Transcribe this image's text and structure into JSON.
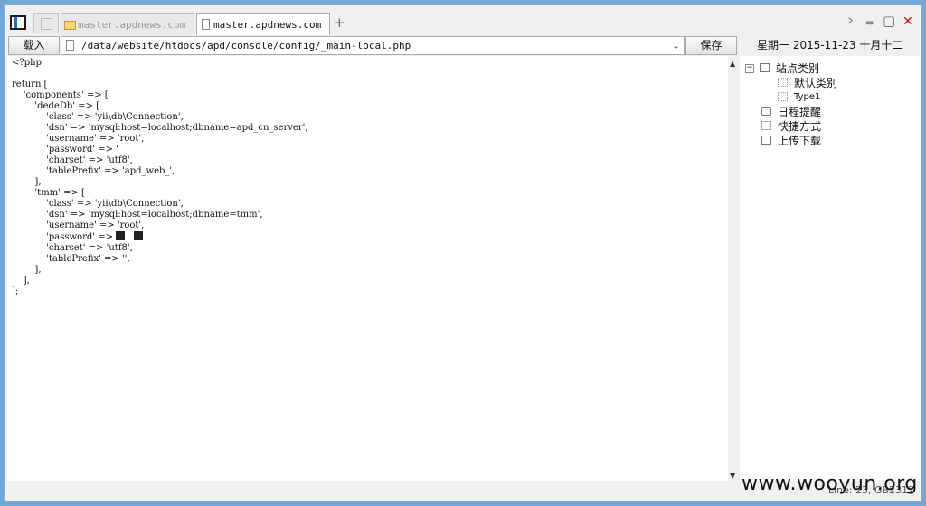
{
  "tabs": [
    {
      "label": "master.apdnews.com",
      "active": false
    },
    {
      "label": "master.apdnews.com",
      "active": true
    }
  ],
  "new_tab_label": "+",
  "window_controls": {
    "forward": "›",
    "minimize": "▬",
    "maximize": "▢",
    "close": "✕"
  },
  "toolbar": {
    "load_label": "载入",
    "save_label": "保存"
  },
  "path": {
    "value": "/data/website/htdocs/apd/console/config/_main-local.php"
  },
  "date": {
    "text": "星期一  2015-11-23  十月十二"
  },
  "code": {
    "lines": [
      "<?php",
      "",
      "return [",
      "    'components' => [",
      "        'dedeDb' => [",
      "            'class' => 'yii\\db\\Connection',",
      "            'dsn' => 'mysql:host=localhost;dbname=apd_cn_server',",
      "            'username' => 'root',",
      "            'password' => '",
      "            'charset' => 'utf8',",
      "            'tablePrefix' => 'apd_web_',",
      "        ],",
      "        'tmm' => [",
      "            'class' => 'yii\\db\\Connection',",
      "            'dsn' => 'mysql:host=localhost;dbname=tmm',",
      "            'username' => 'root',",
      "            'password' => ",
      "            'charset' => 'utf8',",
      "            'tablePrefix' => '',",
      "        ],",
      "    ],",
      "];"
    ]
  },
  "sidebar": {
    "root": {
      "label": "站点类别",
      "expander": "−"
    },
    "children": [
      {
        "label": "默认类别"
      },
      {
        "label": "Type1"
      }
    ],
    "items": [
      {
        "label": "日程提醒"
      },
      {
        "label": "快捷方式"
      },
      {
        "label": "上传下载"
      }
    ]
  },
  "status": {
    "line_info": "Line: 23, GB2312"
  },
  "watermark": "www.wooyun.org",
  "scroll": {
    "up": "▲",
    "down": "▼"
  }
}
